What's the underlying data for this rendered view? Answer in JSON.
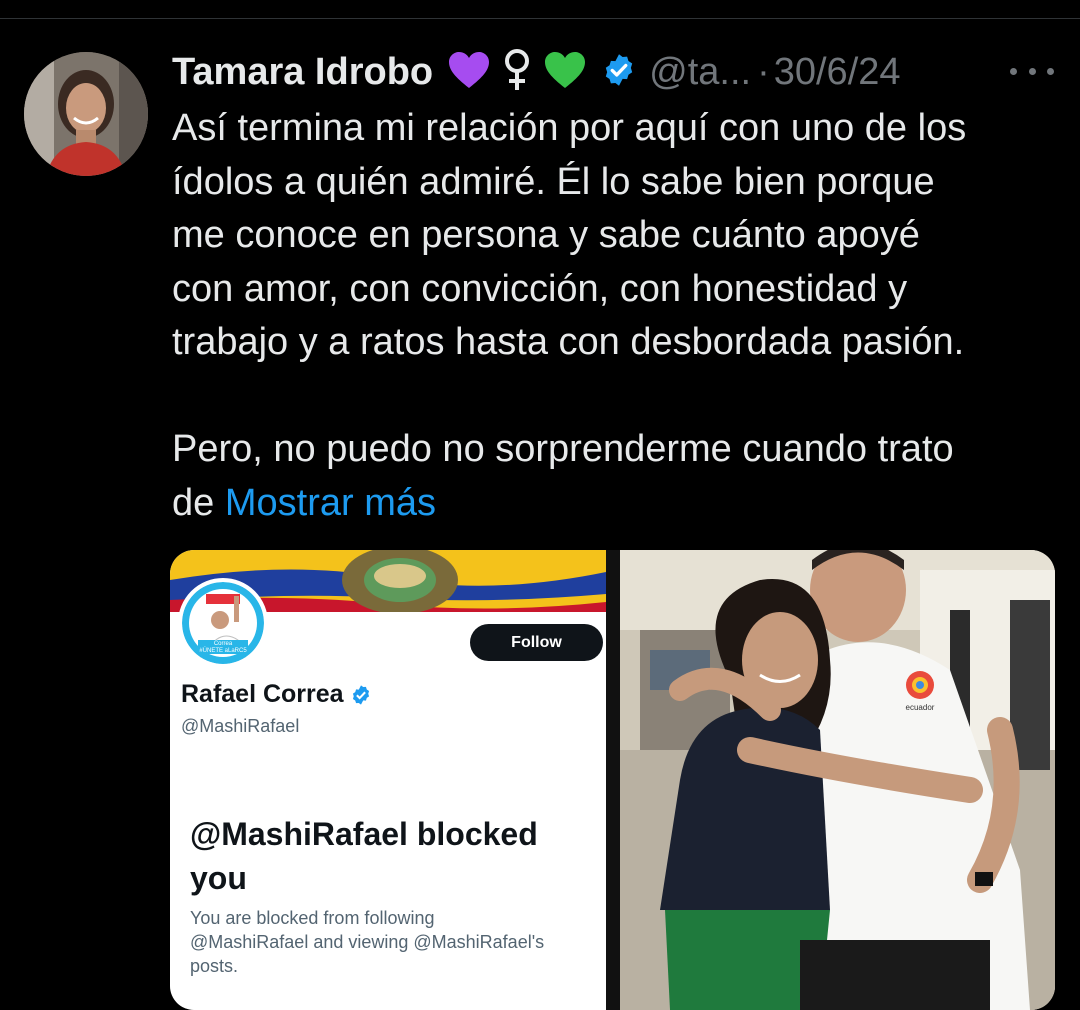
{
  "tweet": {
    "author_name": "Tamara Idrobo",
    "author_emojis": [
      "purple-heart",
      "female-sign",
      "green-heart"
    ],
    "verified": true,
    "handle": "@ta...",
    "separator": "·",
    "date": "30/6/24",
    "text_lines": [
      "Así termina mi relación por aquí con uno de los",
      "ídolos a quién admiré. Él lo sabe bien porque",
      "me conoce en persona y sabe cuánto apoyé",
      "con amor, con convicción, con honestidad y",
      "trabajo y a ratos hasta con desbordada pasión."
    ],
    "text_line_2": "Pero, no puedo no sorprenderme cuando trato",
    "text_prefix": "de",
    "show_more": "Mostrar más"
  },
  "media": {
    "screenshot": {
      "follow_label": "Follow",
      "profile_name": "Rafael Correa",
      "profile_handle": "@MashiRafael",
      "blocked_title_line1": "@MashiRafael blocked",
      "blocked_title_line2": "you",
      "blocked_desc_line1": "You are blocked from following",
      "blocked_desc_line2": "@MashiRafael and viewing @MashiRafael's",
      "blocked_desc_line3": "posts.",
      "avatar_text_top": "Correa",
      "avatar_text_bottom": "#ÚNETE aLaRC5"
    },
    "photo": {
      "shirt_text": "ecuador"
    }
  },
  "colors": {
    "background": "#000000",
    "text": "#e7e9ea",
    "muted": "#71767b",
    "link": "#1d9bf0",
    "verified": "#1d9bf0"
  }
}
